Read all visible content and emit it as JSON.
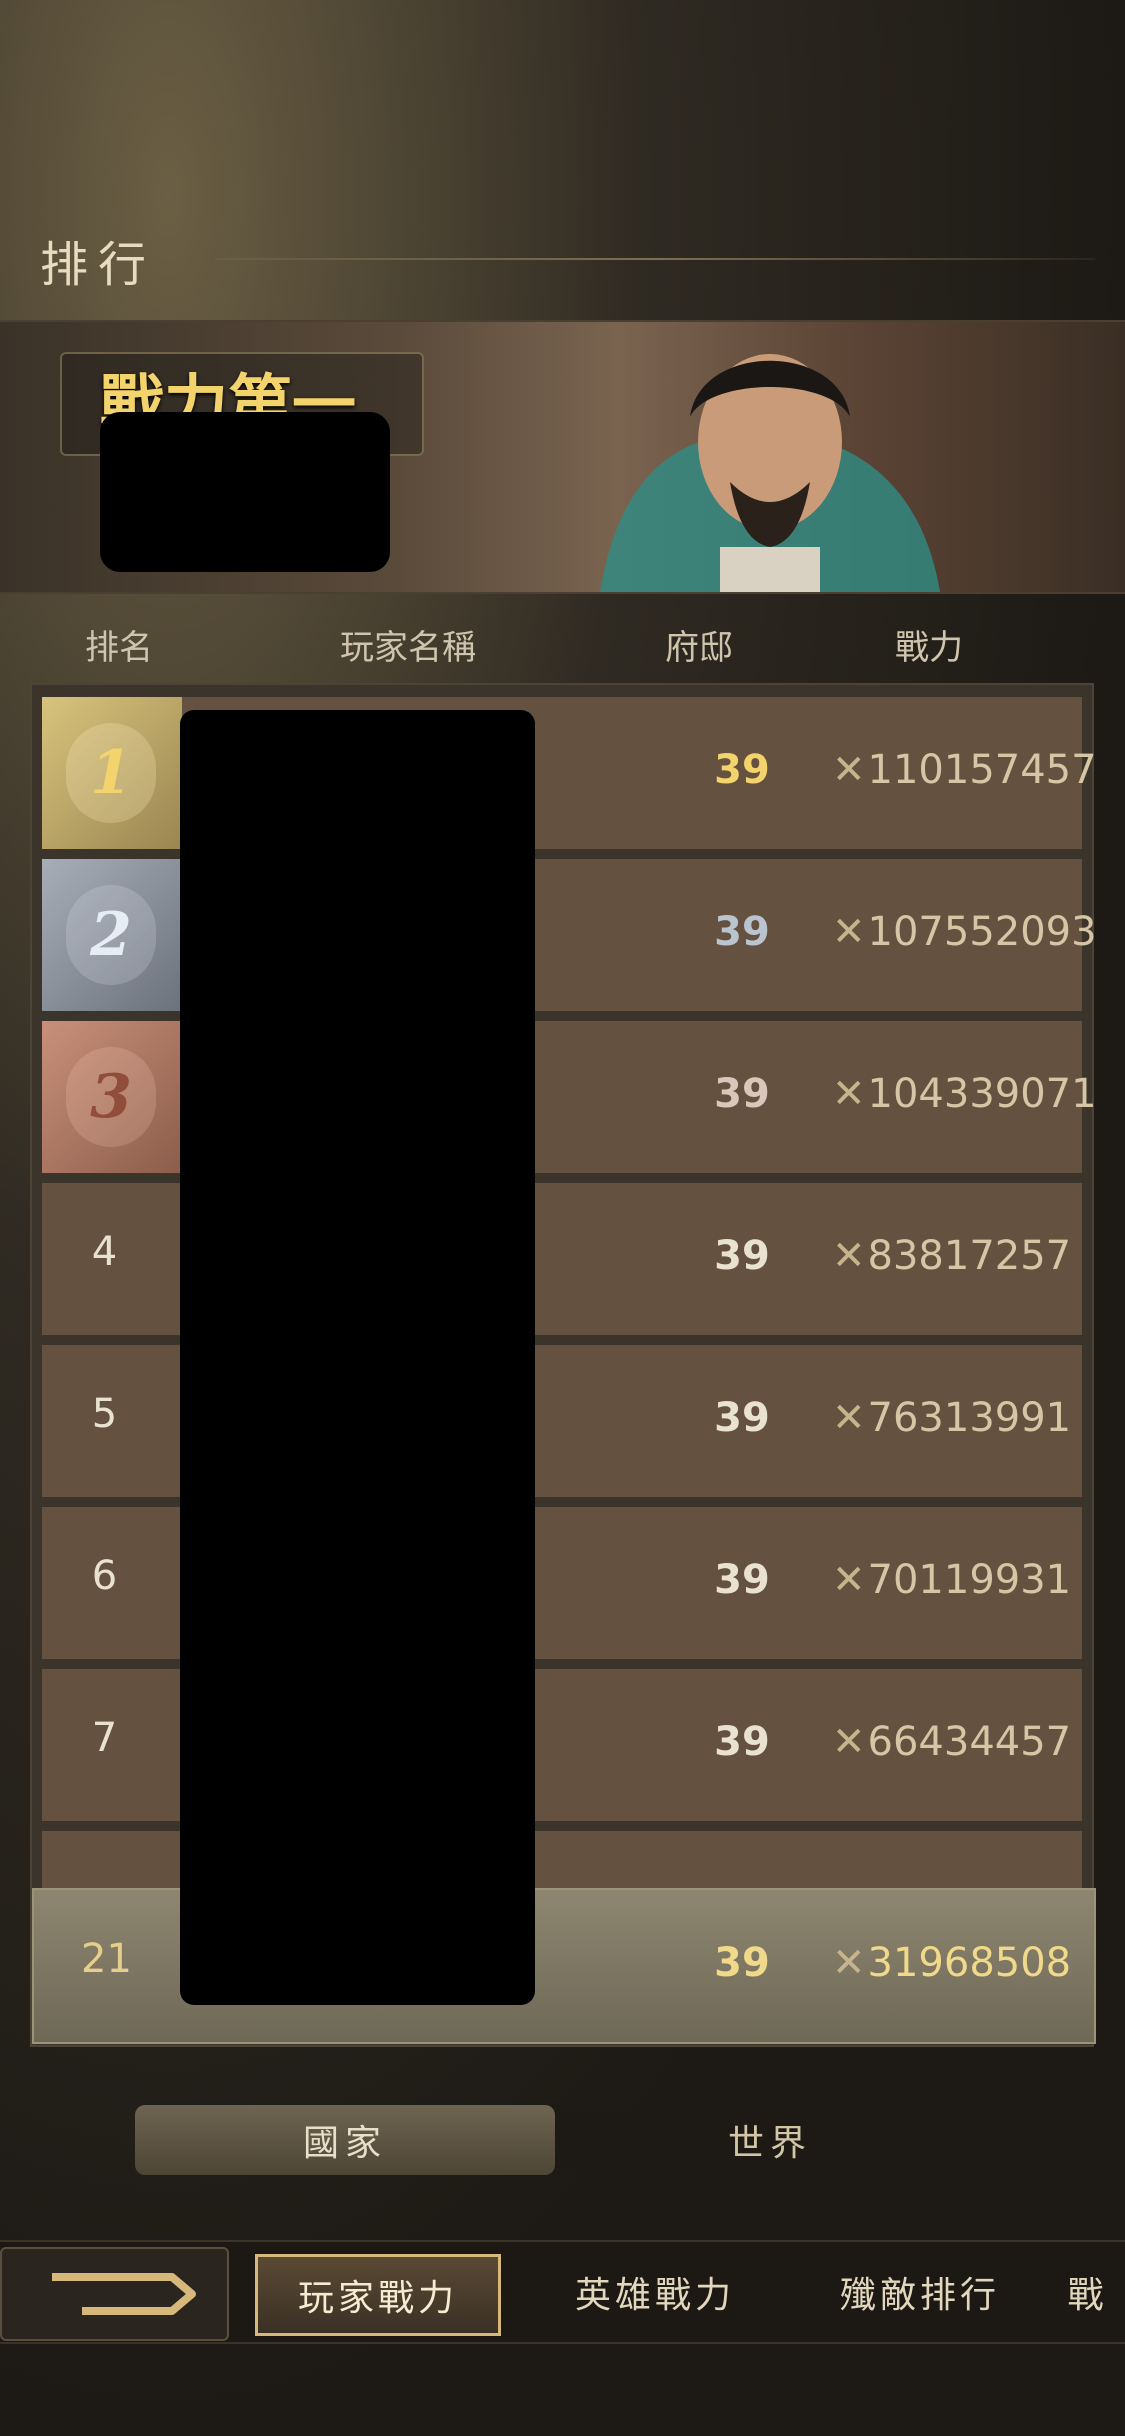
{
  "header": {
    "title": "排行"
  },
  "banner": {
    "title": "戰力第一"
  },
  "columns": {
    "rank": "排名",
    "player": "玩家名稱",
    "mansion": "府邸",
    "power": "戰力"
  },
  "rows": [
    {
      "rank": "1",
      "level": "39",
      "power": "110157457"
    },
    {
      "rank": "2",
      "level": "39",
      "power": "107552093"
    },
    {
      "rank": "3",
      "level": "39",
      "power": "104339071"
    },
    {
      "rank": "4",
      "level": "39",
      "power": "83817257"
    },
    {
      "rank": "5",
      "level": "39",
      "power": "76313991"
    },
    {
      "rank": "6",
      "level": "39",
      "power": "70119931"
    },
    {
      "rank": "7",
      "level": "39",
      "power": "66434457"
    }
  ],
  "me": {
    "rank": "21",
    "level": "39",
    "power": "31968508"
  },
  "filter": {
    "country": "國家",
    "world": "世界"
  },
  "nav": {
    "tab1": "玩家戰力",
    "tab2": "英雄戰力",
    "tab3": "殲敵排行",
    "tab4": "戰"
  },
  "colors": {
    "gold": "#f3d36b",
    "silver": "#b9c4cf",
    "bronze": "#c08d76"
  }
}
